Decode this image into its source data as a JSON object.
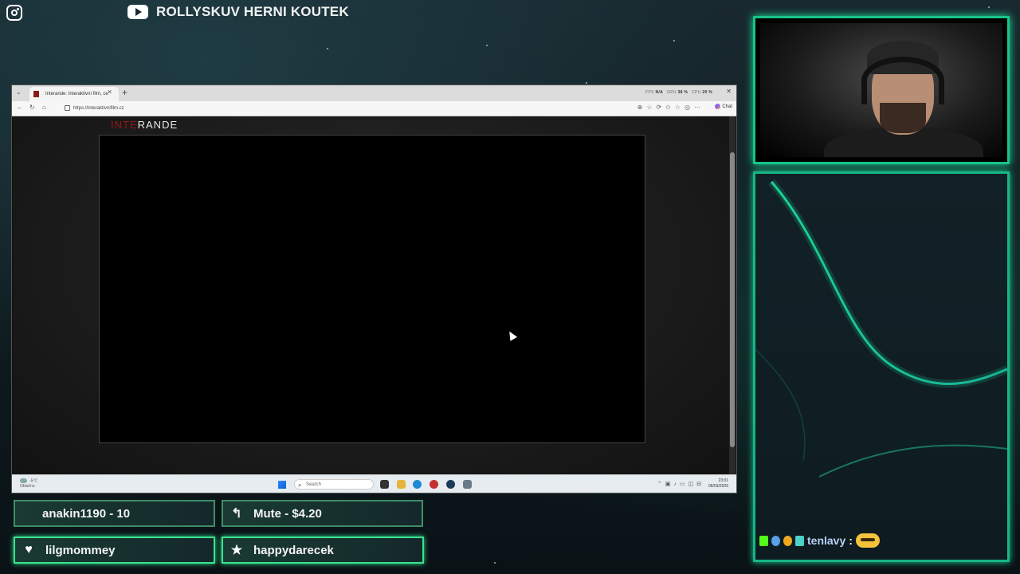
{
  "overlay": {
    "instagram_icon": "instagram-icon",
    "youtube_icon": "youtube-icon",
    "channel_title": "ROLLYSKUV HERNI KOUTEK"
  },
  "browser": {
    "tab_title": "Interande: Interaktivní film, ce",
    "tab_close": "×",
    "new_tab": "+",
    "url": "https://interaktivnifilm.cz",
    "stats": {
      "fps_label": "FPS",
      "fps_value": "N/A",
      "gpu_label": "GPU",
      "gpu_value": "38 %",
      "cpu_label": "CPU",
      "cpu_value": "20 %"
    },
    "chat_label": "Chat",
    "site_logo": {
      "part1": "INTE",
      "part2": "RANDE"
    }
  },
  "taskbar": {
    "weather_temp": "-5°C",
    "weather_desc": "Oblačno",
    "search_placeholder": "Search",
    "time": "23:01",
    "date": "06/03/2026"
  },
  "alerts": {
    "top_left": "anakin1190 - 10",
    "top_right": "Mute - $4.20",
    "bottom_left": "lilgmommey",
    "bottom_right": "happydarecek"
  },
  "chat": {
    "username": "tenlavy",
    "separator": ":"
  },
  "colors": {
    "accent_green": "#18c48c",
    "logo_red": "#9a1414"
  }
}
